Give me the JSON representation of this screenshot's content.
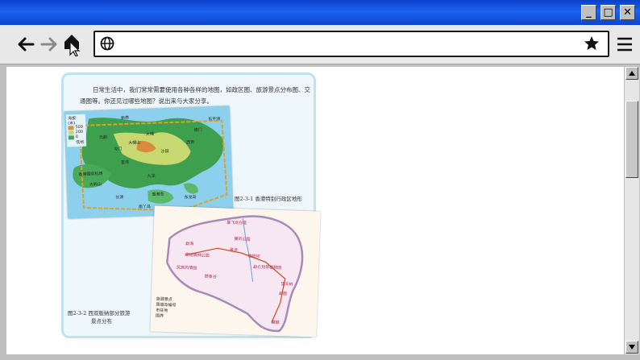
{
  "window": {
    "minimize_glyph": "_",
    "maximize_glyph": "□",
    "close_glyph": "✕"
  },
  "toolbar": {
    "back_icon": "arrow-left-icon",
    "forward_icon": "arrow-right-icon",
    "home_icon": "home-icon",
    "globe_icon": "globe-icon",
    "bookmark_icon": "star-icon",
    "menu_icon": "hamburger-menu-icon",
    "url_value": ""
  },
  "page": {
    "intro_text": "日常生活中，我们常常需要使用各种各样的地图，如政区图、旅游景点分布图、交通图等。你还见过哪些地图？说出来与大家分享。",
    "figure1_caption": "图2-3-1  香港特别行政区地形",
    "figure2_caption_line1": "图2-3-2  西双版纳部分旅游",
    "figure2_caption_line2": "景点分布",
    "map1_legend_title": "海拔",
    "map1_legend_unit": "(米)",
    "map1_legend_values": [
      "500",
      "200",
      "0"
    ],
    "map1_legend_lowland": "低地",
    "map1_places": [
      "香港国际机场",
      "大屿山",
      "九龙",
      "香港岛",
      "新界",
      "元朗",
      "大埔",
      "沙田",
      "荃湾",
      "屯门",
      "西贡",
      "长洲",
      "南丫岛",
      "大帽山",
      "东龙岛",
      "塔门",
      "东平洲"
    ],
    "map2_places": [
      "曼飞龙白塔",
      "勐海",
      "景洪",
      "橄榄坝",
      "勐仑热带植物园",
      "野象谷",
      "望天树",
      "勐腊",
      "磨憨",
      "基诺山寨",
      "打洛",
      "原始森林公园",
      "曼听公园",
      "民族风情园"
    ],
    "map2_legend": [
      "旅游景点",
      "国道及编号",
      "市驻地",
      "国界"
    ]
  },
  "colors": {
    "titlebar": "#1c63ee",
    "toolbar": "#e8e8e8",
    "card_border": "#bfe1f0",
    "sea": "#8cd0ee"
  }
}
